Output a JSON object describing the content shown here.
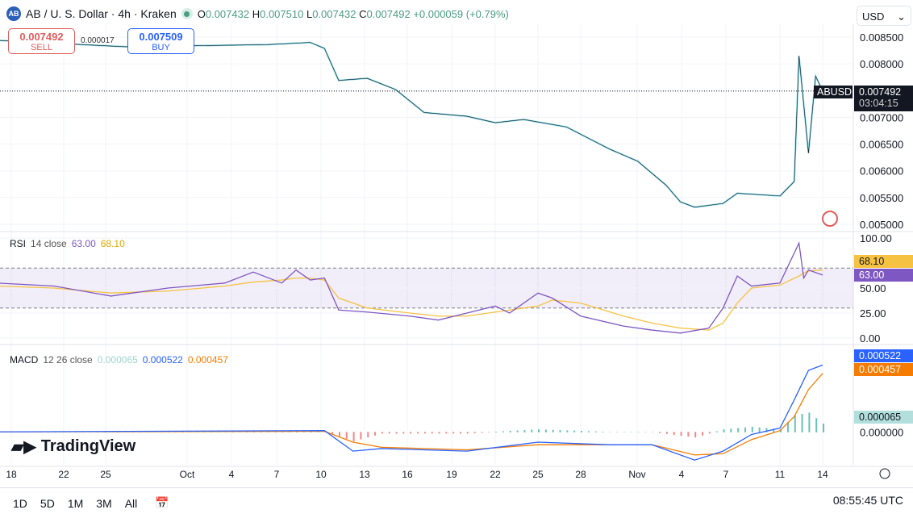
{
  "header": {
    "symbol": "AB / U. S. Dollar · 4h · Kraken",
    "logo": "AB",
    "open_label": "O",
    "open": "0.007432",
    "high_label": "H",
    "high": "0.007510",
    "low_label": "L",
    "low": "0.007432",
    "close_label": "C",
    "close": "0.007492",
    "change": "+0.000059 (+0.79%)"
  },
  "trade": {
    "sell_price": "0.007492",
    "sell_label": "SELL",
    "spread": "0.000017",
    "buy_price": "0.007509",
    "buy_label": "BUY"
  },
  "currency": "USD",
  "price_tag": {
    "symbol": "ABUSD",
    "price": "0.007492",
    "countdown": "03:04:15"
  },
  "rsi": {
    "label": "RSI",
    "params": "14 close",
    "value": "63.00",
    "ma": "68.10"
  },
  "macd": {
    "label": "MACD",
    "params": "12 26 close",
    "hist": "0.000065",
    "macd": "0.000522",
    "signal": "0.000457"
  },
  "branding": "TradingView",
  "toolbar": {
    "ranges": [
      "1D",
      "5D",
      "1M",
      "3M",
      "All"
    ],
    "time": "08:55:45 UTC"
  },
  "colors": {
    "up": "#26a69a",
    "down": "#131722",
    "candle_up": "#7fd3e0",
    "rsi": "#7e57c2",
    "rsi_ma": "#f5c242",
    "macd": "#2962ff",
    "signal": "#f57c00",
    "hist_pos": "#26a69a",
    "hist_neg": "#ef5350"
  },
  "chart_data": {
    "type": "line",
    "price": {
      "ylim": [
        0.005,
        0.0085
      ],
      "yticks": [
        "0.008500",
        "0.008000",
        "0.007500",
        "0.007000",
        "0.006500",
        "0.006000",
        "0.005500",
        "0.005000"
      ],
      "x": [
        "09-17",
        "09-26",
        "10-06",
        "10-09",
        "10-10",
        "10-11",
        "10-13",
        "10-15",
        "10-17",
        "10-20",
        "10-22",
        "10-24",
        "10-27",
        "10-30",
        "11-01",
        "11-03",
        "11-04",
        "11-05",
        "11-07",
        "11-08",
        "11-11",
        "11-12",
        "11-12T08",
        "11-13",
        "11-13T12",
        "11-14"
      ],
      "y": [
        0.00844,
        0.00832,
        0.00836,
        0.0084,
        0.00829,
        0.00769,
        0.00773,
        0.00752,
        0.00709,
        0.00702,
        0.0069,
        0.00696,
        0.00682,
        0.00641,
        0.00618,
        0.00573,
        0.00542,
        0.00532,
        0.00539,
        0.00558,
        0.00553,
        0.0058,
        0.00815,
        0.00633,
        0.00777,
        0.007492
      ]
    },
    "rsi": {
      "ylim": [
        0,
        100
      ],
      "yticks": [
        "100.00",
        "75.00",
        "50.00",
        "25.00",
        "0.00"
      ],
      "bands": [
        30,
        70
      ],
      "x": [
        "09-17",
        "09-21",
        "09-25",
        "09-29",
        "10-03",
        "10-05",
        "10-07",
        "10-08",
        "10-09",
        "10-10",
        "10-11",
        "10-13",
        "10-16",
        "10-18",
        "10-20",
        "10-22",
        "10-23",
        "10-25",
        "10-26",
        "10-28",
        "10-31",
        "11-02",
        "11-04",
        "11-06",
        "11-07",
        "11-08",
        "11-09",
        "11-11",
        "11-12T08",
        "11-12T16",
        "11-13",
        "11-14"
      ],
      "rsi": [
        55,
        52,
        42,
        50,
        55,
        66,
        55,
        68,
        58,
        60,
        28,
        26,
        22,
        18,
        25,
        32,
        25,
        45,
        40,
        22,
        12,
        8,
        5,
        10,
        30,
        62,
        52,
        55,
        95,
        60,
        68,
        63
      ],
      "ma": [
        52,
        50,
        45,
        47,
        52,
        56,
        58,
        60,
        60,
        58,
        40,
        30,
        25,
        22,
        22,
        26,
        28,
        32,
        38,
        35,
        22,
        15,
        10,
        8,
        15,
        35,
        50,
        53,
        62,
        65,
        67,
        68.1
      ]
    },
    "macd": {
      "ylim": [
        -0.00025,
        0.0006
      ],
      "x": [
        "09-17",
        "10-10",
        "10-12",
        "10-14",
        "10-20",
        "10-25",
        "10-30",
        "11-02",
        "11-05",
        "11-07",
        "11-09",
        "11-11",
        "11-12",
        "11-13",
        "11-14"
      ],
      "macd": [
        0,
        1e-05,
        -0.00015,
        -0.00013,
        -0.00015,
        -8e-05,
        -0.0001,
        -0.0001,
        -0.00022,
        -0.00015,
        -2e-05,
        3e-05,
        0.00025,
        0.00048,
        0.000522
      ],
      "signal": [
        0,
        5e-06,
        -8e-05,
        -0.00012,
        -0.00014,
        -0.0001,
        -0.0001,
        -0.0001,
        -0.00018,
        -0.00017,
        -6e-05,
        1e-05,
        0.00012,
        0.00033,
        0.000457
      ]
    },
    "xticks": [
      "18",
      "22",
      "25",
      "Oct",
      "4",
      "7",
      "10",
      "13",
      "16",
      "19",
      "22",
      "25",
      "28",
      "Nov",
      "4",
      "7",
      "11",
      "14"
    ]
  }
}
